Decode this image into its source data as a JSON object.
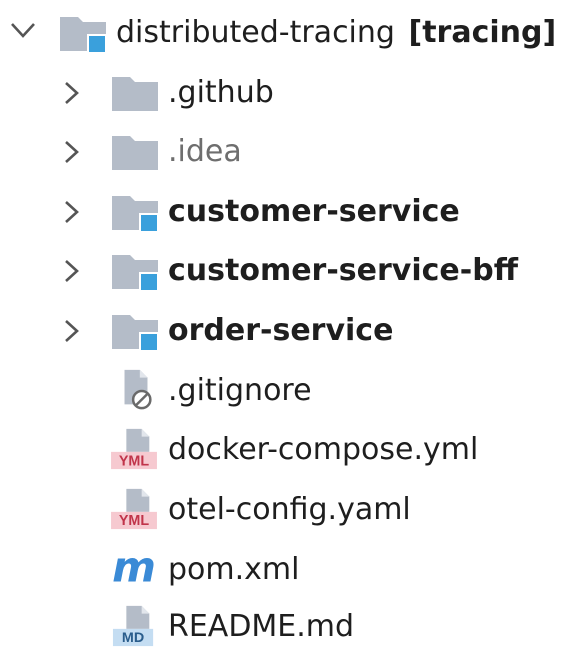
{
  "tree": {
    "root": {
      "name": "distributed-tracing",
      "module_tag": "[tracing]",
      "expanded": true,
      "icon": "module-folder-icon"
    },
    "items": [
      {
        "name": ".github",
        "type": "folder",
        "icon": "folder-icon",
        "expandable": true,
        "style": "normal"
      },
      {
        "name": ".idea",
        "type": "folder",
        "icon": "folder-icon",
        "expandable": true,
        "style": "muted"
      },
      {
        "name": "customer-service",
        "type": "module",
        "icon": "module-folder-icon",
        "expandable": true,
        "style": "bold"
      },
      {
        "name": "customer-service-bff",
        "type": "module",
        "icon": "module-folder-icon",
        "expandable": true,
        "style": "bold"
      },
      {
        "name": "order-service",
        "type": "module",
        "icon": "module-folder-icon",
        "expandable": true,
        "style": "bold"
      },
      {
        "name": ".gitignore",
        "type": "file",
        "icon": "ignored-file-icon",
        "expandable": false,
        "style": "normal"
      },
      {
        "name": "docker-compose.yml",
        "type": "file",
        "icon": "yaml-file-icon",
        "expandable": false,
        "style": "normal"
      },
      {
        "name": "otel-config.yaml",
        "type": "file",
        "icon": "yaml-file-icon",
        "expandable": false,
        "style": "normal"
      },
      {
        "name": "pom.xml",
        "type": "file",
        "icon": "maven-icon",
        "expandable": false,
        "style": "normal"
      },
      {
        "name": "README.md",
        "type": "file",
        "icon": "markdown-file-icon",
        "expandable": false,
        "style": "normal"
      }
    ],
    "icon_badges": {
      "yaml": "YML",
      "markdown": "MD",
      "maven": "m"
    }
  },
  "colors": {
    "folder": "#b4bcc8",
    "module_badge": "#3aa0dc",
    "yaml_badge_bg": "#f6c9d0",
    "yaml_badge_text": "#c0344a",
    "md_badge_bg": "#c4ddf2",
    "md_badge_text": "#2a5d8c",
    "maven": "#3a8ad6",
    "chevron": "#555555"
  }
}
